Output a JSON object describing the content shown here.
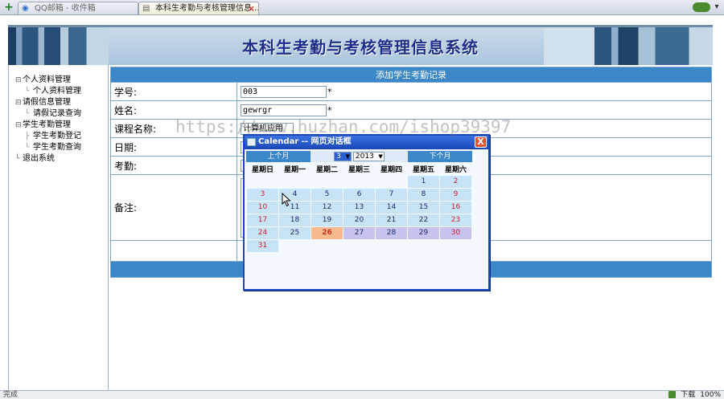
{
  "browser": {
    "tabs": [
      {
        "label": "QQ邮箱 - 收件箱",
        "active": false
      },
      {
        "label": "本科生考勤与考核管理信息...",
        "active": true
      }
    ]
  },
  "banner": {
    "title": "本科生考勤与考核管理信息系统"
  },
  "nav": {
    "items": [
      {
        "label": "个人资料管理",
        "children": [
          {
            "label": "个人资料管理"
          }
        ]
      },
      {
        "label": "请假信息管理",
        "children": [
          {
            "label": "请假记录查询"
          }
        ]
      },
      {
        "label": "学生考勤管理",
        "children": [
          {
            "label": "学生考勤登记"
          },
          {
            "label": "学生考勤查询"
          }
        ]
      },
      {
        "label": "退出系统",
        "children": []
      }
    ]
  },
  "form": {
    "header": "添加学生考勤记录",
    "fields": {
      "student_id": {
        "label": "学号:",
        "value": "003",
        "required": "*"
      },
      "name": {
        "label": "姓名:",
        "value": "gewrgr",
        "required": "*"
      },
      "course": {
        "label": "课程名称:",
        "value": "计算机应用"
      },
      "date": {
        "label": "日期:"
      },
      "attendance": {
        "label": "考勤:"
      },
      "remark": {
        "label": "备注:"
      }
    }
  },
  "calendar": {
    "title": "Calendar -- 网页对话框",
    "prev": "上个月",
    "next": "下个月",
    "month": "3",
    "year": "2013",
    "weekdays": [
      "星期日",
      "星期一",
      "星期二",
      "星期三",
      "星期四",
      "星期五",
      "星期六"
    ],
    "weeks": [
      [
        "",
        "",
        "",
        "",
        "",
        "1",
        "2"
      ],
      [
        "3",
        "4",
        "5",
        "6",
        "7",
        "8",
        "9"
      ],
      [
        "10",
        "11",
        "12",
        "13",
        "14",
        "15",
        "16"
      ],
      [
        "17",
        "18",
        "19",
        "20",
        "21",
        "22",
        "23"
      ],
      [
        "24",
        "25",
        "26",
        "27",
        "28",
        "29",
        "30"
      ],
      [
        "31",
        "",
        "",
        "",
        "",
        "",
        ""
      ]
    ],
    "today": "26",
    "close": "X"
  },
  "watermark": "https://www.huzhan.com/ishop39397",
  "status": {
    "left": "完成",
    "download": "下载",
    "zoom": "100%"
  },
  "colors": {
    "header_blue": "#3b87c8",
    "cell_border": "#7ba7cf",
    "calendar_today": "#f7b98e",
    "calendar_weekend_text": "#d81c2a",
    "dialog_title": "#1d46b8"
  }
}
